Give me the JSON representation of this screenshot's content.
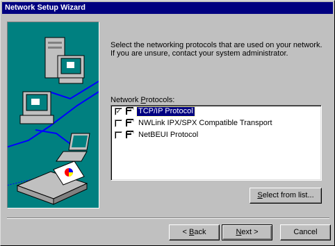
{
  "window": {
    "title": "Network Setup Wizard"
  },
  "description": {
    "line1": "Select the networking protocols that are used on your network.",
    "line2": "If you are unsure, contact your system administrator."
  },
  "protocols": {
    "label_prefix": "Network ",
    "label_hotkey": "P",
    "label_suffix": "rotocols:",
    "items": [
      {
        "label": "TCP/IP Protocol",
        "checked": true,
        "selected": true
      },
      {
        "label": "NWLink IPX/SPX Compatible Transport",
        "checked": false,
        "selected": false
      },
      {
        "label": "NetBEUI Protocol",
        "checked": false,
        "selected": false
      }
    ]
  },
  "buttons": {
    "select_hotkey": "S",
    "select_rest": "elect from list...",
    "back_prefix": "< ",
    "back_hotkey": "B",
    "back_rest": "ack",
    "next_hotkey": "N",
    "next_rest": "ext >",
    "cancel": "Cancel"
  },
  "icons": {
    "protocol": "network-protocol-icon",
    "checkmark": "✓"
  },
  "colors": {
    "titlebar": "#000080",
    "art_bg": "#008080",
    "face": "#c0c0c0"
  }
}
